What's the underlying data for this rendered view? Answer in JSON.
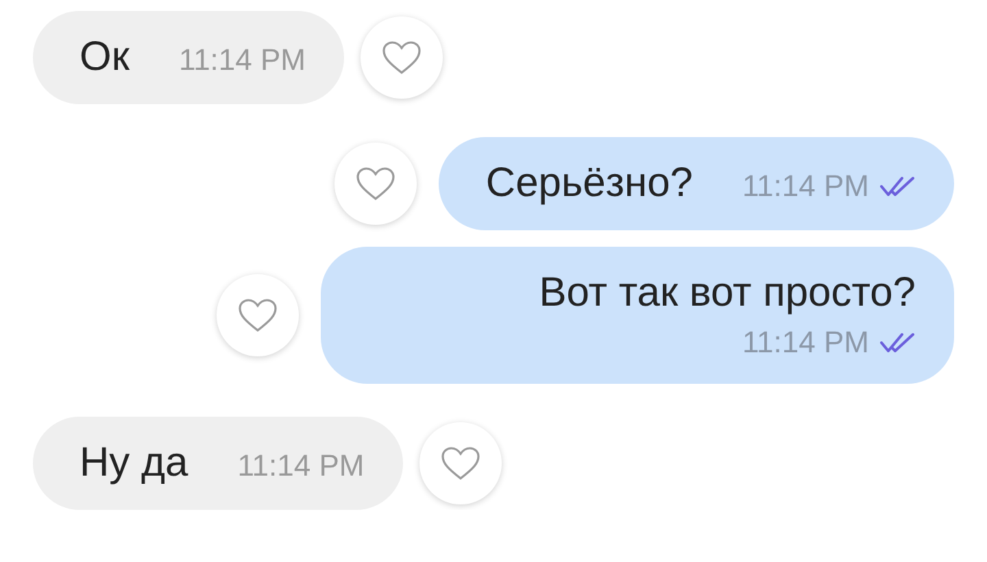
{
  "messages": [
    {
      "kind": "incoming",
      "text": "Ок",
      "time": "11:14 PM",
      "liked": false
    },
    {
      "kind": "outgoing",
      "text": "Серьёзно?",
      "time": "11:14 PM",
      "read": true,
      "liked": false
    },
    {
      "kind": "outgoing",
      "text": "Вот так вот просто?",
      "time": "11:14 PM",
      "read": true,
      "liked": false
    },
    {
      "kind": "incoming",
      "text": "Ну да",
      "time": "11:14 PM",
      "liked": false
    }
  ]
}
